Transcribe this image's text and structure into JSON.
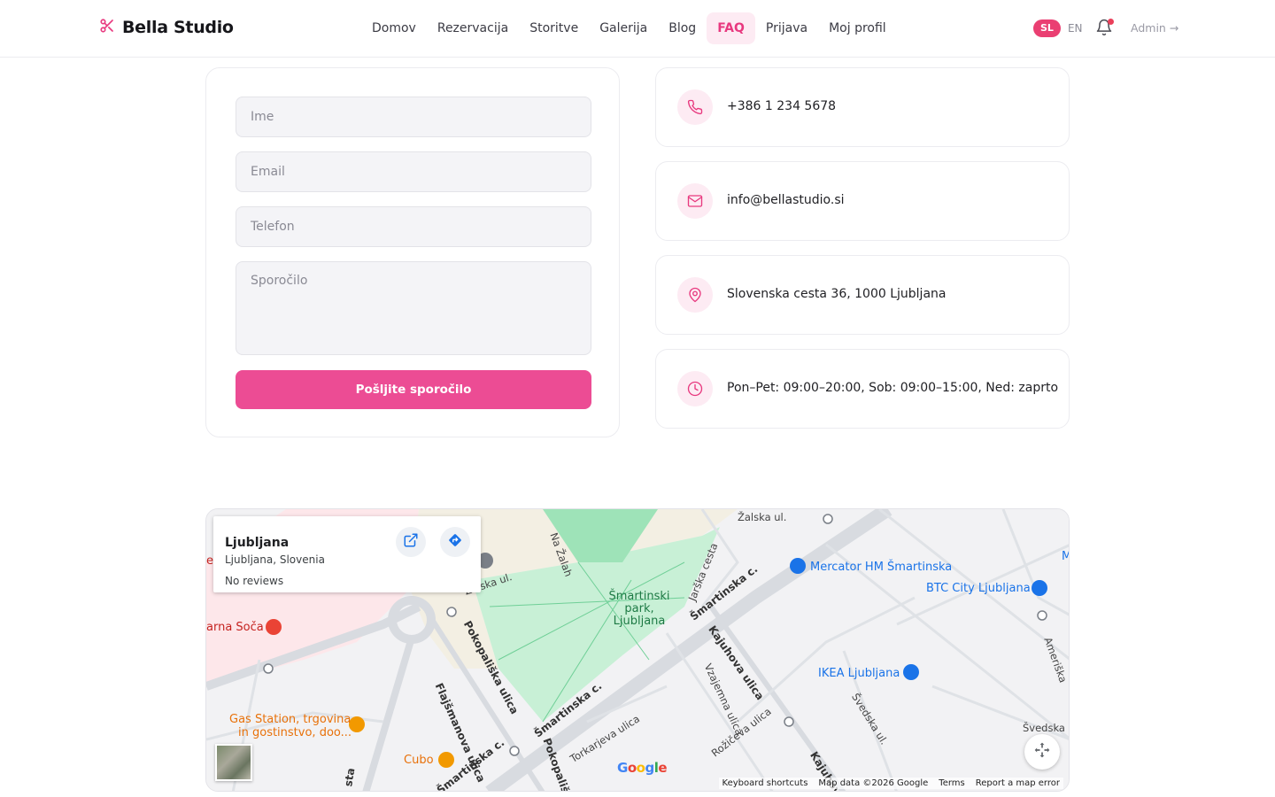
{
  "brand": {
    "name": "Bella Studio",
    "accent": "#e8397f",
    "button_color": "#ec4c94"
  },
  "nav": {
    "items": [
      {
        "label": "Domov"
      },
      {
        "label": "Rezervacija"
      },
      {
        "label": "Storitve"
      },
      {
        "label": "Galerija"
      },
      {
        "label": "Blog"
      },
      {
        "label": "FAQ",
        "active": true
      },
      {
        "label": "Prijava"
      },
      {
        "label": "Moj profil"
      }
    ]
  },
  "header": {
    "lang_active": "SL",
    "lang_other": "EN",
    "admin_label": "Admin →",
    "bell_icon": "bell-icon"
  },
  "form": {
    "name_placeholder": "Ime",
    "email_placeholder": "Email",
    "phone_placeholder": "Telefon",
    "message_placeholder": "Sporočilo",
    "submit_label": "Pošljite sporočilo"
  },
  "contact": [
    {
      "icon": "phone-icon",
      "text": "+386 1 234 5678"
    },
    {
      "icon": "mail-icon",
      "text": "info@bellastudio.si"
    },
    {
      "icon": "location-pin-icon",
      "text": "Slovenska cesta 36, 1000 Ljubljana"
    },
    {
      "icon": "clock-icon",
      "text": "Pon–Pet: 09:00–20:00, Sob: 09:00–15:00, Ned: zaprto"
    }
  ],
  "map": {
    "place_title": "Ljubljana",
    "place_subtitle": "Ljubljana, Slovenia",
    "place_reviews": "No reviews",
    "pois": {
      "mercator": "Mercator HM Šmartinska",
      "btc": "BTC City Ljubljana",
      "ikea": "IKEA Ljubljana",
      "gas_line1": "Gas Station, trgovina",
      "gas_line2": "in gostinstvo, doo...",
      "cubo": "Cubo",
      "soca": "arna Soča",
      "park": "Šmartinski park, Ljubljana",
      "edge_m": "M",
      "edge_el": "el"
    },
    "streets": {
      "zalska1": "Žalska ul.",
      "zalska2": "Žalska ul.",
      "na_zalah": "Na Žalah",
      "jarska": "Jarška cesta",
      "smartinska1": "Šmartinska c.",
      "smartinska2": "Šmartinska c.",
      "smartinska3": "Šmartinska c.",
      "kajuhova1": "Kajuhova ulica",
      "kajuhova2": "Kajuhova",
      "pokopaliska1": "Pokopališka ulica",
      "pokopaliska2": "Pokopališka",
      "flajsmanova": "Flajšmanova ulica",
      "vzajemna": "Vzajemna ulica",
      "rozniceva": "Rožičeva ulica",
      "torkarjeva": "Torkarjeva ulica",
      "svedska1": "Švedska ul.",
      "svedska2": "Švedska u",
      "ameriska": "Ameriška",
      "sta": "sta"
    },
    "google_logo": "Google",
    "footer": {
      "shortcuts": "Keyboard shortcuts",
      "data": "Map data ©2026 Google",
      "terms": "Terms",
      "report": "Report a map error"
    }
  }
}
